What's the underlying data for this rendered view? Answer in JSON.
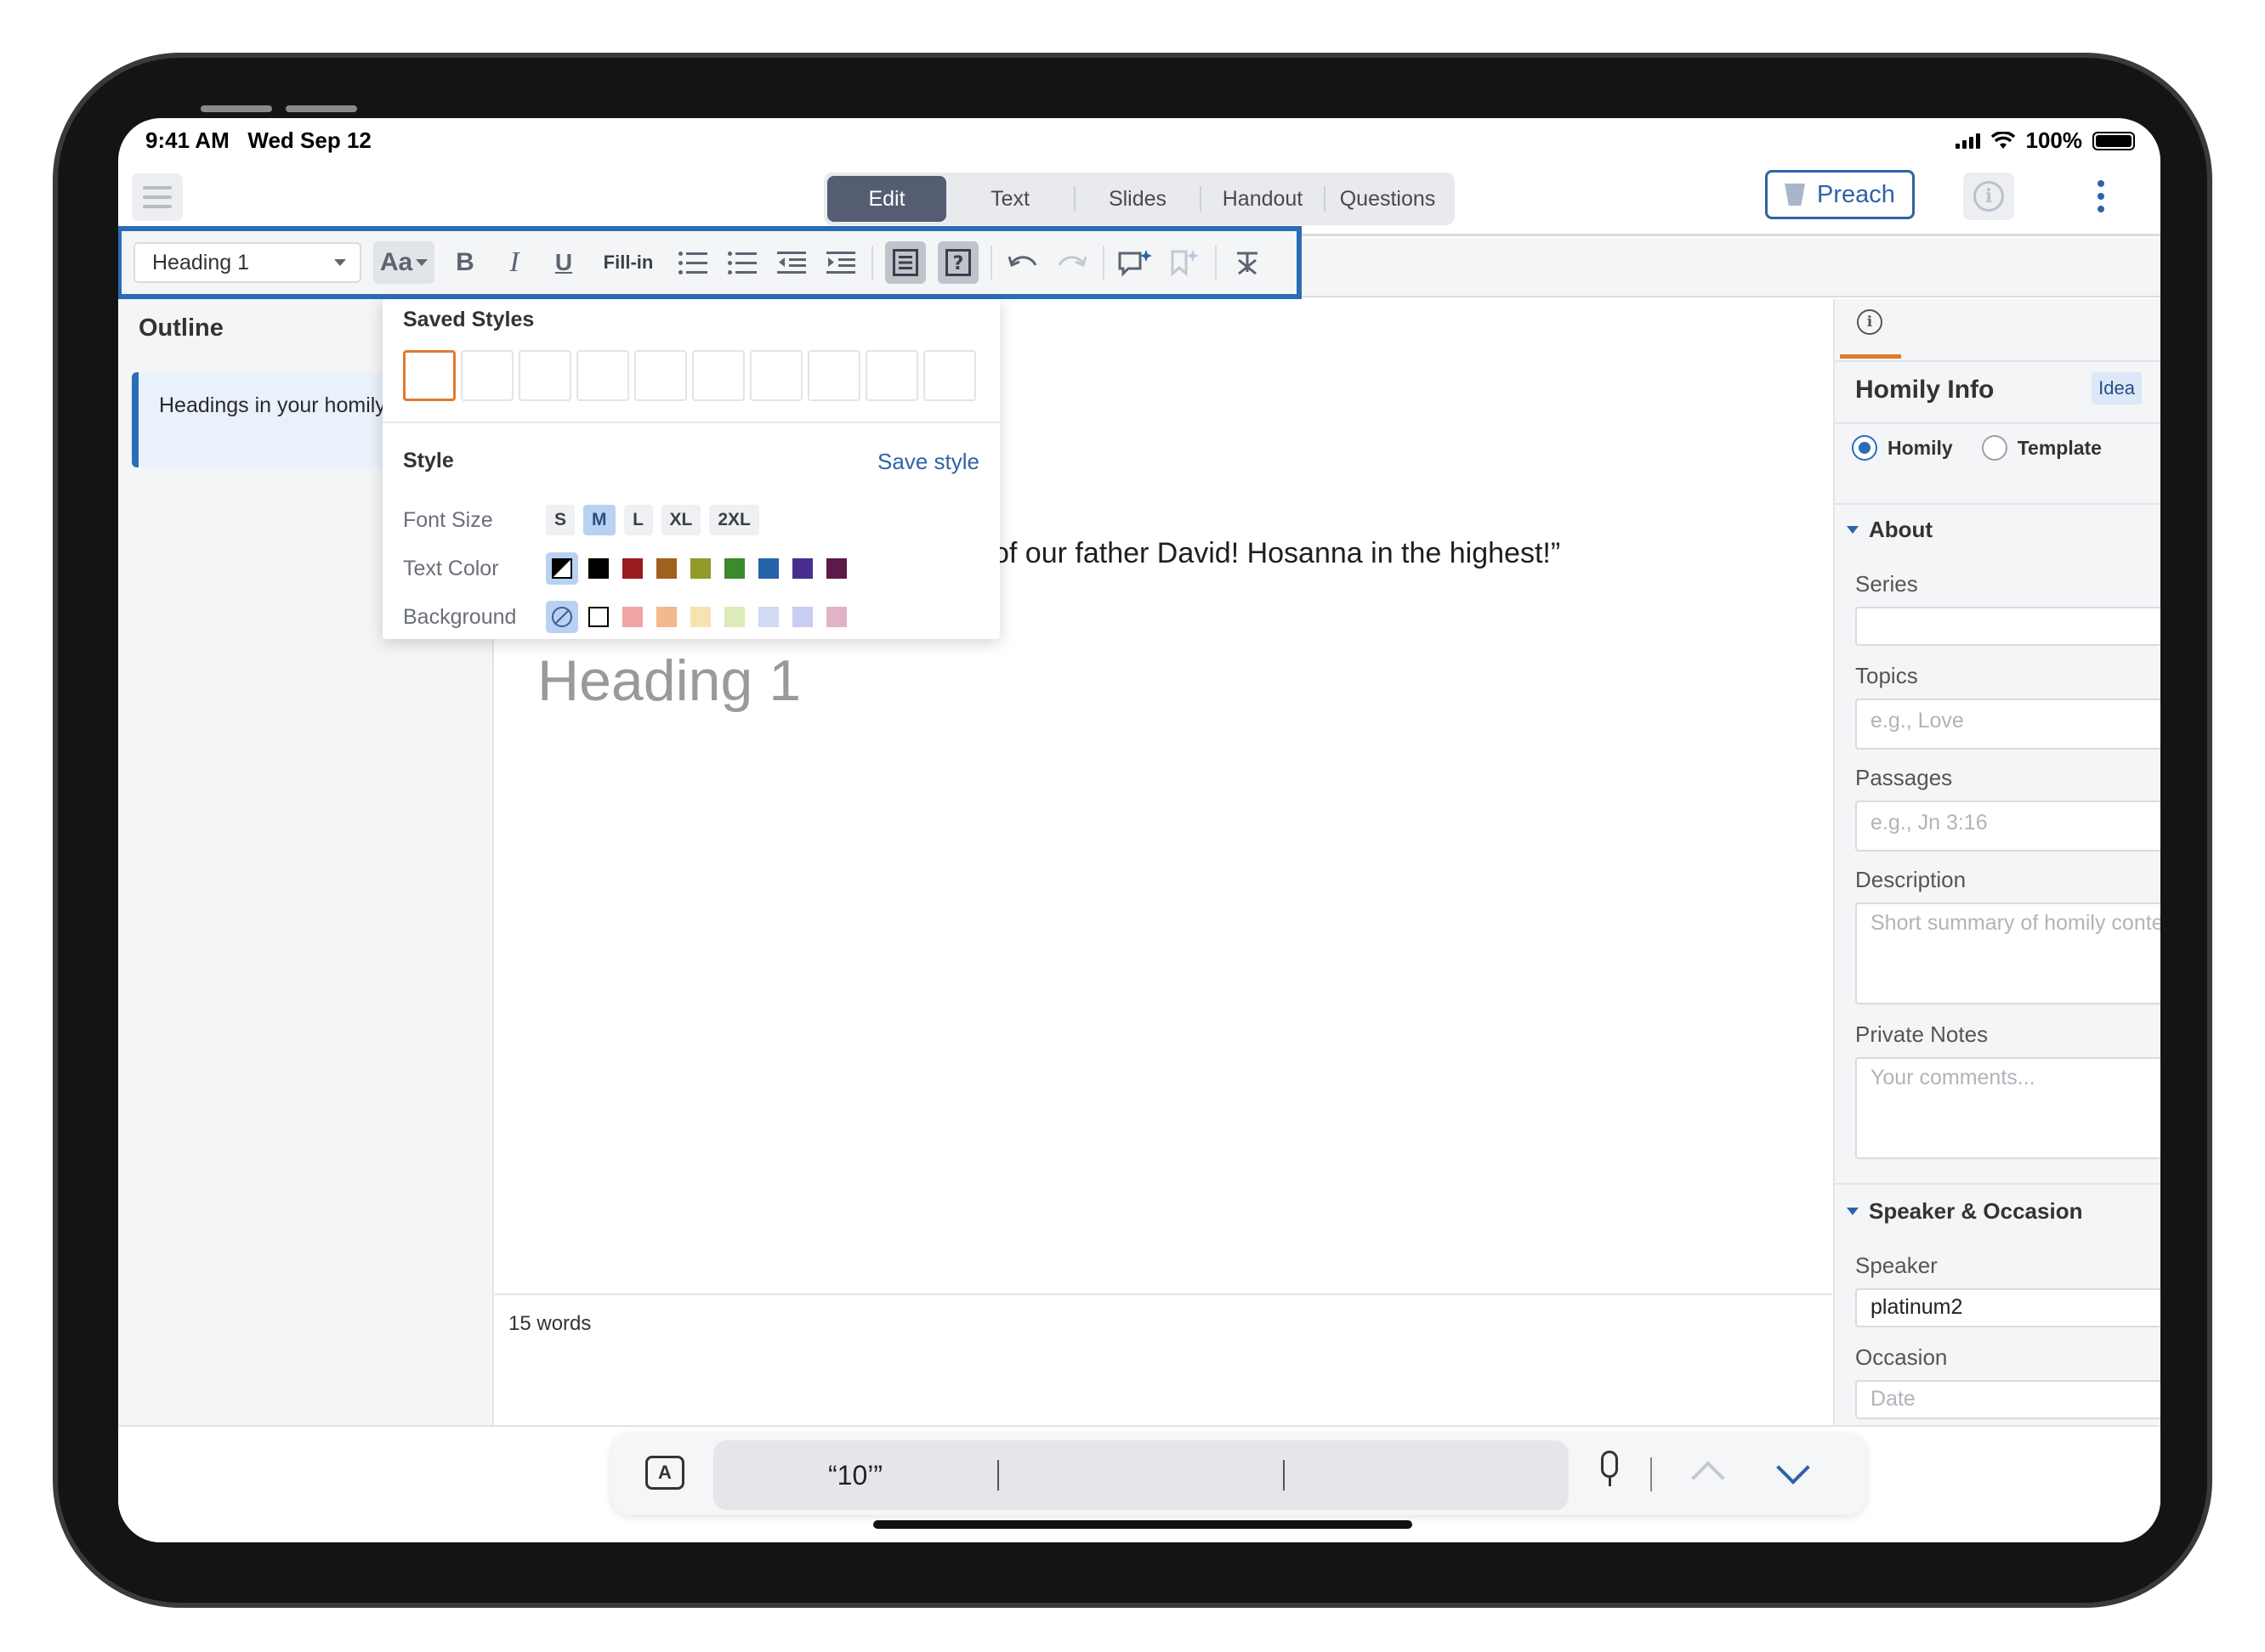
{
  "status_bar": {
    "time": "9:41 AM",
    "date": "Wed Sep 12",
    "battery": "100%"
  },
  "header": {
    "tabs": [
      {
        "label": "Edit",
        "active": true
      },
      {
        "label": "Text",
        "active": false
      },
      {
        "label": "Slides",
        "active": false
      },
      {
        "label": "Handout",
        "active": false
      },
      {
        "label": "Questions",
        "active": false
      }
    ],
    "preach_label": "Preach"
  },
  "toolbar": {
    "style_select": "Heading 1",
    "font_btn": "Aa",
    "bold": "B",
    "italic": "I",
    "underline": "U",
    "fill_in": "Fill-in",
    "highlight_color": "#2b6cb7"
  },
  "outline": {
    "title": "Outline",
    "hint": "Headings in your homily will appear here."
  },
  "editor": {
    "quote": "of our father David! Hosanna in the highest!”",
    "heading_placeholder": "Heading 1",
    "word_count": "15 words"
  },
  "style_popup": {
    "saved_styles_title": "Saved Styles",
    "style_title": "Style",
    "save_style_label": "Save style",
    "font_size_label": "Font Size",
    "font_sizes": [
      "S",
      "M",
      "L",
      "XL",
      "2XL"
    ],
    "font_size_selected": "M",
    "text_color_label": "Text Color",
    "text_colors": [
      "#000000",
      "#9b1c1c",
      "#a0601e",
      "#8f9a2b",
      "#3b8a2b",
      "#2563a8",
      "#4a2e8f",
      "#5c1a4a"
    ],
    "background_label": "Background",
    "background_colors": [
      "#f2a3a3",
      "#f3b98c",
      "#f6e3b0",
      "#dcebb8",
      "#cfdcf3",
      "#c9ccf4",
      "#e0b3c6"
    ]
  },
  "homily_info": {
    "title": "Homily Info",
    "badge": "Idea",
    "radio_homily": "Homily",
    "radio_template": "Template",
    "about_section": "About",
    "series_label": "Series",
    "series_value": "",
    "topics_label": "Topics",
    "topics_placeholder": "e.g., Love",
    "passages_label": "Passages",
    "passages_placeholder": "e.g., Jn 3:16",
    "description_label": "Description",
    "description_placeholder": "Short summary of homily content...",
    "private_notes_label": "Private Notes",
    "private_notes_placeholder": "Your comments...",
    "speaker_section": "Speaker & Occasion",
    "speaker_label": "Speaker",
    "speaker_value": "platinum2",
    "occasion_label": "Occasion",
    "date_placeholder": "Date"
  },
  "keyboard_bar": {
    "suggestions": [
      "“10’”",
      "",
      ""
    ],
    "key_label": "A"
  }
}
